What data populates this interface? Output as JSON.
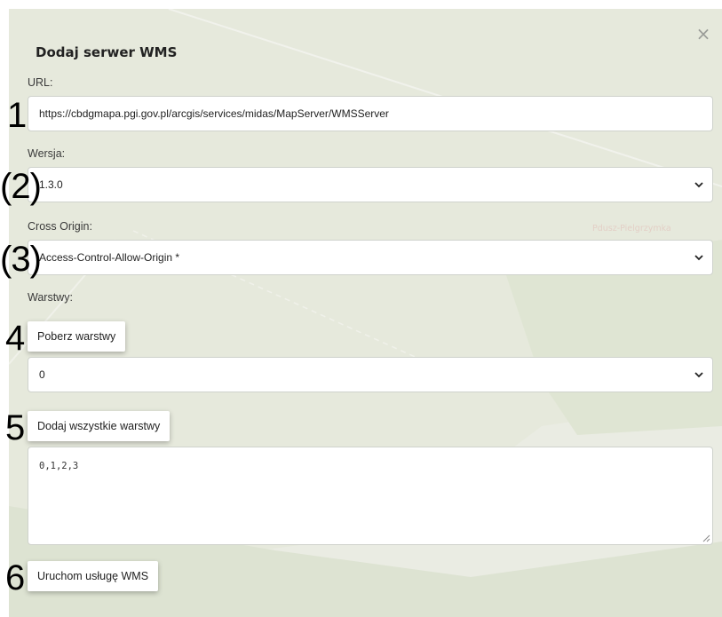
{
  "dialog": {
    "title": "Dodaj serwer WMS",
    "close_label": "×"
  },
  "form": {
    "url_label": "URL:",
    "url_value": "https://cbdgmapa.pgi.gov.pl/arcgis/services/midas/MapServer/WMSServer",
    "version_label": "Wersja:",
    "version_value": "1.3.0",
    "cross_origin_label": "Cross Origin:",
    "cross_origin_value": "Access-Control-Allow-Origin *",
    "layers_label": "Warstwy:",
    "fetch_layers_button": "Poberz warstwy",
    "layer_select_value": "0",
    "add_all_layers_button": "Dodaj wszystkie warstwy",
    "layers_text": "0,1,2,3",
    "start_service_button": "Uruchom usługę WMS"
  },
  "map": {
    "place_label": "Pdusz-Pielgrzymka"
  },
  "step_markers": [
    "1",
    "(2)",
    "(3)",
    "4",
    "5",
    "6"
  ],
  "colors": {
    "map_background": "#e9ebe3",
    "map_patch": "#dde3d2",
    "field_border": "#cfd2cc"
  }
}
